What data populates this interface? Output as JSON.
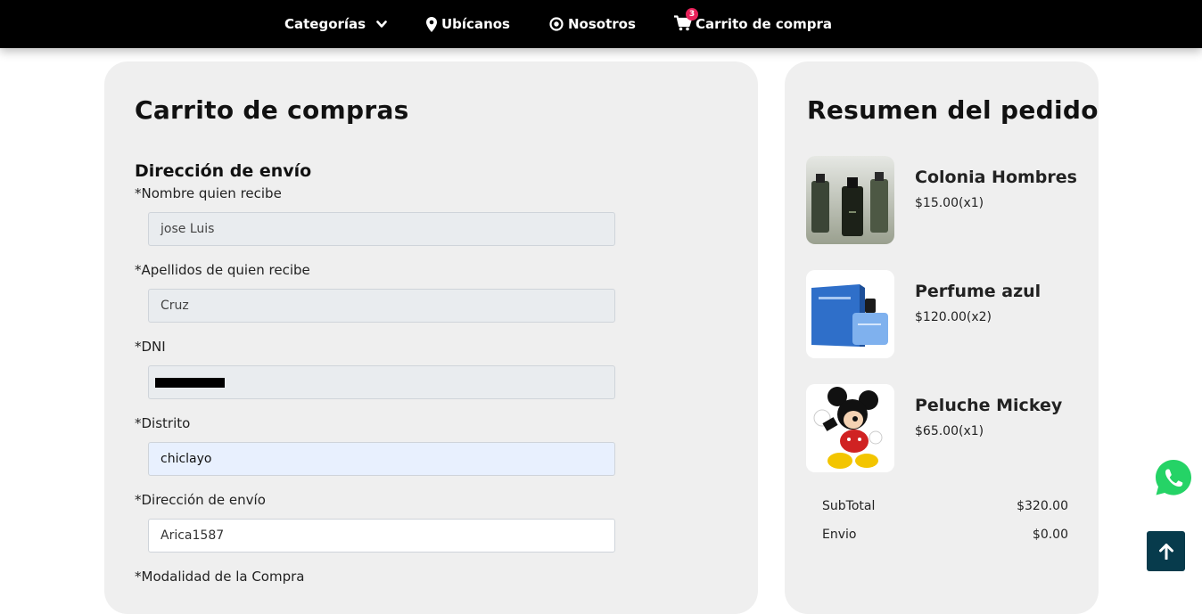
{
  "nav": {
    "categories_label": "Categorías",
    "location_label": "Ubícanos",
    "about_label": "Nosotros",
    "cart_label": "Carrito de compra",
    "cart_count": "3"
  },
  "cart": {
    "title": "Carrito de compras",
    "shipping_heading": "Dirección de envío",
    "fields": {
      "first_name": {
        "label": "*Nombre quien recibe",
        "value": "jose Luis"
      },
      "last_name": {
        "label": "*Apellidos de quien recibe",
        "value": "Cruz"
      },
      "dni": {
        "label": "*DNI"
      },
      "district": {
        "label": "*Distrito",
        "value": "chiclayo"
      },
      "address": {
        "label": "*Dirección de envío",
        "value": "Arica1587"
      },
      "purchase_mode": {
        "label": "*Modalidad de la Compra"
      }
    }
  },
  "summary": {
    "title": "Resumen del pedido",
    "products": [
      {
        "name": "Colonia Hombres",
        "price": "$15.00(x1)",
        "icon": "cologne-bottles-image"
      },
      {
        "name": "Perfume azul",
        "price": "$120.00(x2)",
        "icon": "blue-perfume-image"
      },
      {
        "name": "Peluche Mickey",
        "price": "$65.00(x1)",
        "icon": "mickey-plush-image"
      }
    ],
    "subtotal_label": "SubTotal",
    "subtotal_value": "$320.00",
    "shipping_label": "Envio",
    "shipping_value": "$0.00"
  },
  "colors": {
    "nav_bg": "#000000",
    "panel_bg": "#efefef",
    "badge": "#e8215a",
    "whatsapp": "#25d366",
    "back_to_top": "#073b4c"
  }
}
